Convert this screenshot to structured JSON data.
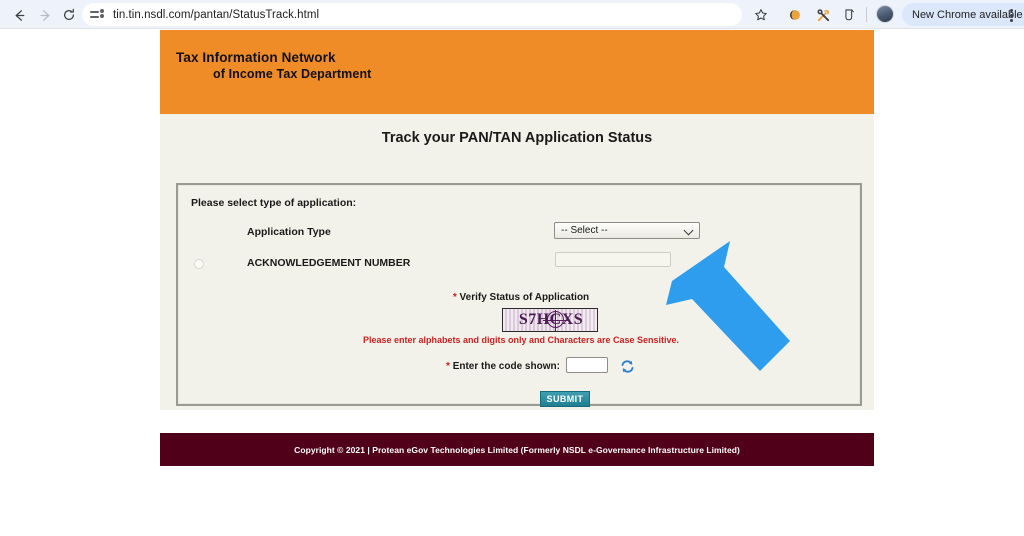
{
  "browser": {
    "back_icon": "back-arrow-icon",
    "forward_icon": "forward-arrow-icon",
    "reload_icon": "reload-icon",
    "site_info_icon": "site-settings-icon",
    "url": "tin.tin.nsdl.com/pantan/StatusTrack.html",
    "bookmark_icon": "star-icon",
    "extension_icon": "extension-crescent-icon",
    "tools_icon": "hammer-and-wrench-icon",
    "labs_icon": "labs-flask-icon",
    "avatar_icon": "profile-avatar",
    "update_pill_label": "New Chrome available",
    "overflow_icon": "three-dot-menu-icon"
  },
  "page": {
    "banner": {
      "title_line1": "Tax Information Network",
      "title_line2": "of Income Tax Department",
      "background_color": "#f08c28"
    },
    "heading": "Track your PAN/TAN Application Status",
    "form": {
      "legend": "Please select type of application:",
      "application_type_label": "Application Type",
      "application_type_value": "-- Select --",
      "application_type_options": [
        "-- Select --"
      ],
      "acknowledgement_label": "ACKNOWLEDGEMENT NUMBER",
      "acknowledgement_value": "",
      "acknowledgement_placeholder": "",
      "verify_required_mark": "*",
      "verify_label": "Verify Status of Application",
      "captcha_text": "S7HCXS",
      "captcha_hint": "Please enter alphabets and digits only and Characters are Case Sensitive.",
      "code_required_mark": "*",
      "code_label": "Enter the code shown:",
      "code_value": "",
      "refresh_icon": "refresh-captcha-icon",
      "submit_label": "SUBMIT"
    },
    "footer": {
      "text": "Copyright © 2021 | Protean eGov Technologies Limited (Formerly NSDL e-Governance Infrastructure Limited)",
      "background_color": "#500018"
    }
  },
  "annotation": {
    "arrow_color": "#2f9ded",
    "arrow_points_to": "application-type-select"
  }
}
